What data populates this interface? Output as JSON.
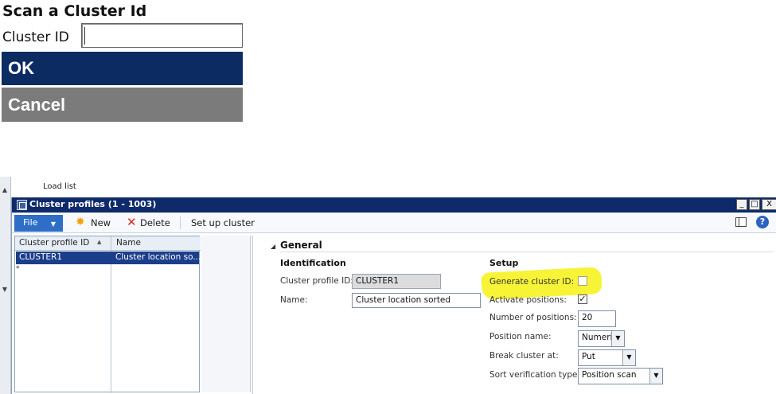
{
  "scan_form": {
    "title": "Scan a Cluster Id",
    "field_label": "Cluster ID",
    "field_value": "",
    "ok_label": "OK",
    "cancel_label": "Cancel",
    "colors": {
      "ok": "#0c2b63",
      "cancel": "#7b7b7b"
    }
  },
  "background": {
    "load_list_label": "Load list"
  },
  "window": {
    "title": "Cluster profiles (1 - 1003)",
    "controls": {
      "minimize": "_",
      "maximize": "□",
      "close": "X"
    },
    "toolbar": {
      "file_label": "File",
      "new_label": "New",
      "delete_label": "Delete",
      "setup_label": "Set up cluster",
      "icons": [
        "layout-icon",
        "help-icon"
      ]
    },
    "grid": {
      "columns": [
        "Cluster profile ID",
        "Name"
      ],
      "rows": [
        {
          "id": "CLUSTER1",
          "name": "Cluster location so..."
        }
      ],
      "new_row_marker": "*"
    },
    "details": {
      "section_title": "General",
      "identification": {
        "heading": "Identification",
        "profile_id_label": "Cluster profile ID:",
        "profile_id_value": "CLUSTER1",
        "name_label": "Name:",
        "name_value": "Cluster location sorted"
      },
      "setup": {
        "heading": "Setup",
        "generate_label": "Generate cluster ID:",
        "generate_checked": false,
        "activate_label": "Activate positions:",
        "activate_checked": true,
        "num_positions_label": "Number of positions:",
        "num_positions_value": "20",
        "position_name_label": "Position name:",
        "position_name_value": "Numeric",
        "break_label": "Break cluster at:",
        "break_value": "Put",
        "sort_label": "Sort verification type:",
        "sort_value": "Position scan"
      },
      "highlight_color": "#f7f22c"
    }
  }
}
